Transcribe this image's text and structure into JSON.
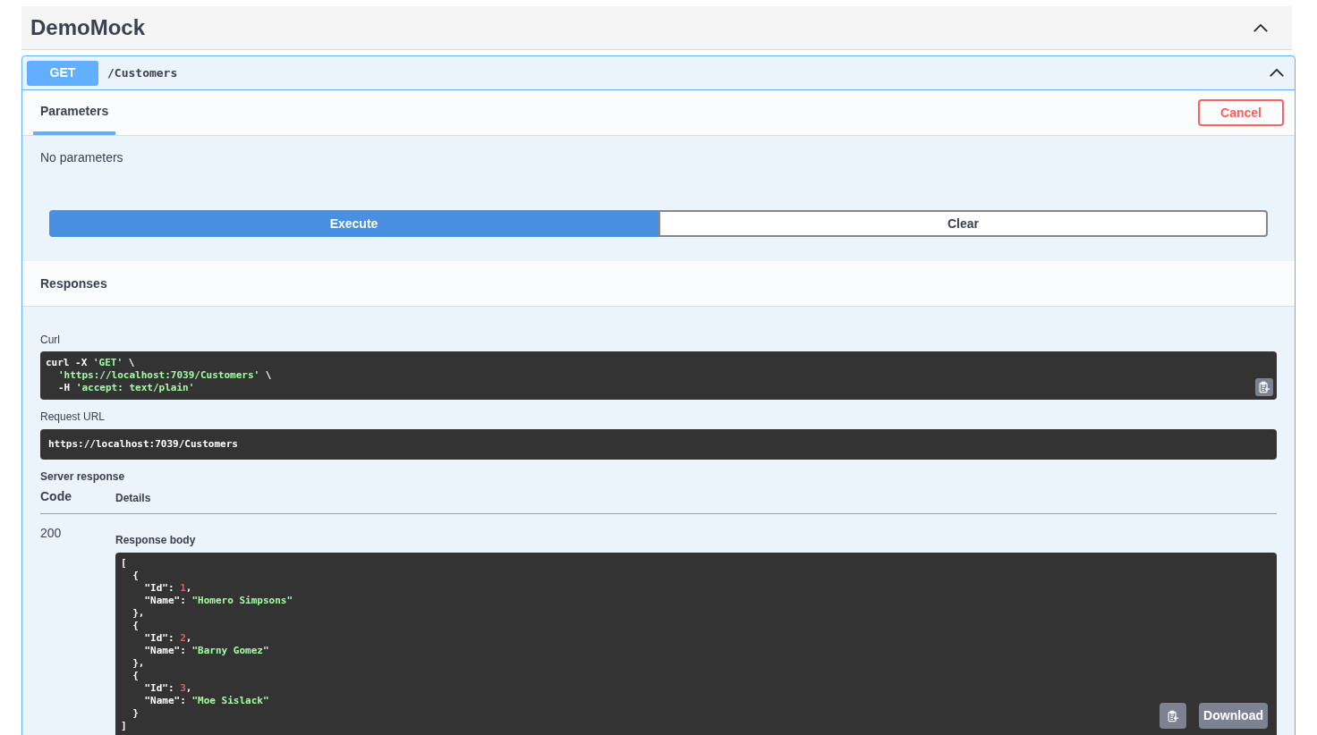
{
  "section": {
    "title": "DemoMock",
    "expanded": true
  },
  "operation": {
    "method": "GET",
    "path": "/Customers",
    "expanded": true
  },
  "tabs": [
    {
      "label": "Parameters",
      "selected": true
    }
  ],
  "cancel_button": "Cancel",
  "parameters_message": "No parameters",
  "execute_button": "Execute",
  "clear_button": "Clear",
  "responses_title": "Responses",
  "curl": {
    "label": "Curl",
    "lines": [
      [
        {
          "kind": "plain",
          "text": "curl -X "
        },
        {
          "kind": "string",
          "text": "'GET'"
        },
        {
          "kind": "plain",
          "text": " \\"
        }
      ],
      {
        "indented": true,
        "tokens": [
          {
            "kind": "string",
            "text": "'https://localhost:7039/Customers'"
          },
          {
            "kind": "plain",
            "text": " \\"
          }
        ]
      },
      {
        "indented": true,
        "tokens": [
          {
            "kind": "plain",
            "text": "-H "
          },
          {
            "kind": "string",
            "text": "'accept: text/plain'"
          }
        ]
      }
    ]
  },
  "request_url": {
    "label": "Request URL",
    "value": "https://localhost:7039/Customers"
  },
  "server_response": {
    "label": "Server response",
    "columns": [
      "Code",
      "Details"
    ],
    "code": "200",
    "body_label": "Response body",
    "download_button": "Download",
    "body_lines": [
      [
        {
          "kind": "plain",
          "text": "["
        }
      ],
      [
        {
          "kind": "plain",
          "text": "  {"
        }
      ],
      [
        {
          "kind": "plain",
          "text": "    \"Id\": "
        },
        {
          "kind": "number",
          "text": "1"
        },
        {
          "kind": "plain",
          "text": ","
        }
      ],
      [
        {
          "kind": "plain",
          "text": "    \"Name\": "
        },
        {
          "kind": "string",
          "text": "\"Homero Simpsons\""
        }
      ],
      [
        {
          "kind": "plain",
          "text": "  },"
        }
      ],
      [
        {
          "kind": "plain",
          "text": "  {"
        }
      ],
      [
        {
          "kind": "plain",
          "text": "    \"Id\": "
        },
        {
          "kind": "number",
          "text": "2"
        },
        {
          "kind": "plain",
          "text": ","
        }
      ],
      [
        {
          "kind": "plain",
          "text": "    \"Name\": "
        },
        {
          "kind": "string",
          "text": "\"Barny Gomez\""
        }
      ],
      [
        {
          "kind": "plain",
          "text": "  },"
        }
      ],
      [
        {
          "kind": "plain",
          "text": "  {"
        }
      ],
      [
        {
          "kind": "plain",
          "text": "    \"Id\": "
        },
        {
          "kind": "number",
          "text": "3"
        },
        {
          "kind": "plain",
          "text": ","
        }
      ],
      [
        {
          "kind": "plain",
          "text": "    \"Name\": "
        },
        {
          "kind": "string",
          "text": "\"Moe Sislack\""
        }
      ],
      [
        {
          "kind": "plain",
          "text": "  }"
        }
      ],
      [
        {
          "kind": "plain",
          "text": "]"
        }
      ]
    ]
  }
}
